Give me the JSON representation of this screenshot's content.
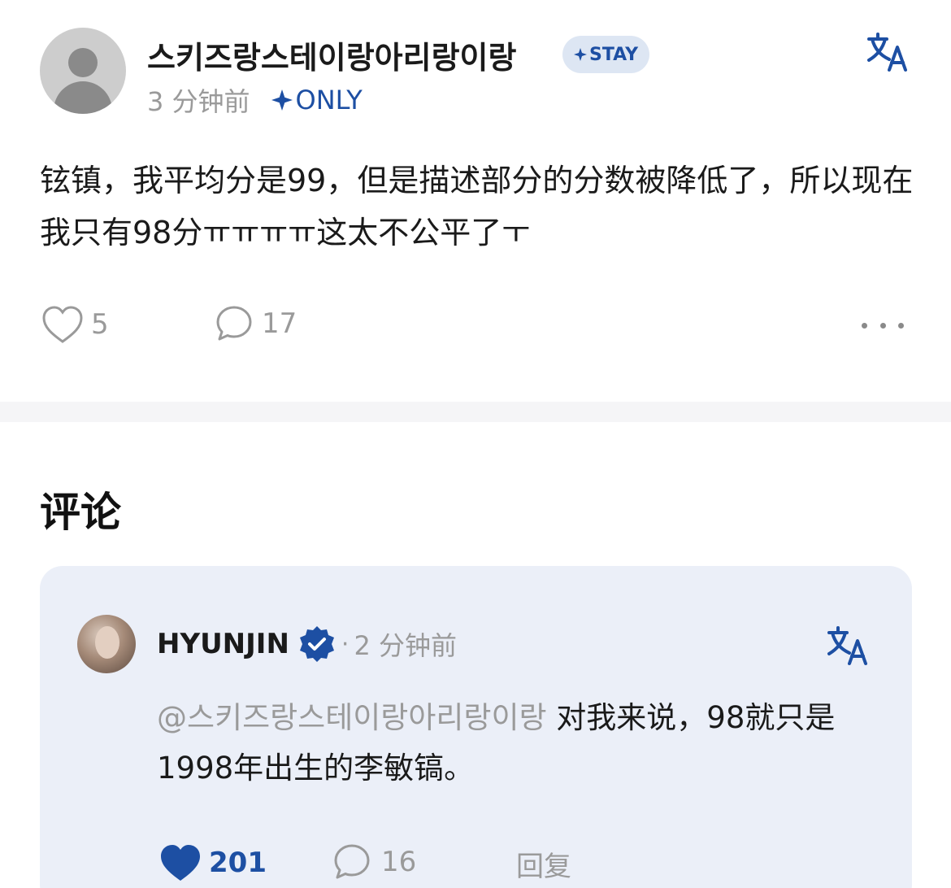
{
  "post": {
    "author_name": "스키즈랑스테이랑아리랑이랑",
    "badge": {
      "icon": "sparkle-icon",
      "label": "STAY"
    },
    "time": "3 分钟前",
    "only_label": "ONLY",
    "translate_icon": "translate-icon",
    "text": "铉镇，我平均分是99，但是描述部分的分数被降低了，所以现在我只有98分ㅠㅠㅠㅠ这太不公平了ㅜ",
    "like_count": "5",
    "comment_count": "17",
    "more_icon": "more-horizontal-icon"
  },
  "comments": {
    "title": "评论",
    "items": [
      {
        "author": "HYUNJIN",
        "verified_icon": "verified-badge-icon",
        "separator": "·",
        "time": "2 分钟前",
        "mention": "@스키즈랑스테이랑아리랑이랑",
        "text": " 对我来说，98就只是1998年出生的李敏镐。",
        "like_count": "201",
        "reply_count": "16",
        "reply_label": "回复"
      }
    ]
  },
  "colors": {
    "accent": "#1d4fa3",
    "badge_bg": "#dde6f3",
    "card_bg": "#ebeff8",
    "muted_text": "#9a9a9a",
    "divider": "#f5f5f7"
  }
}
